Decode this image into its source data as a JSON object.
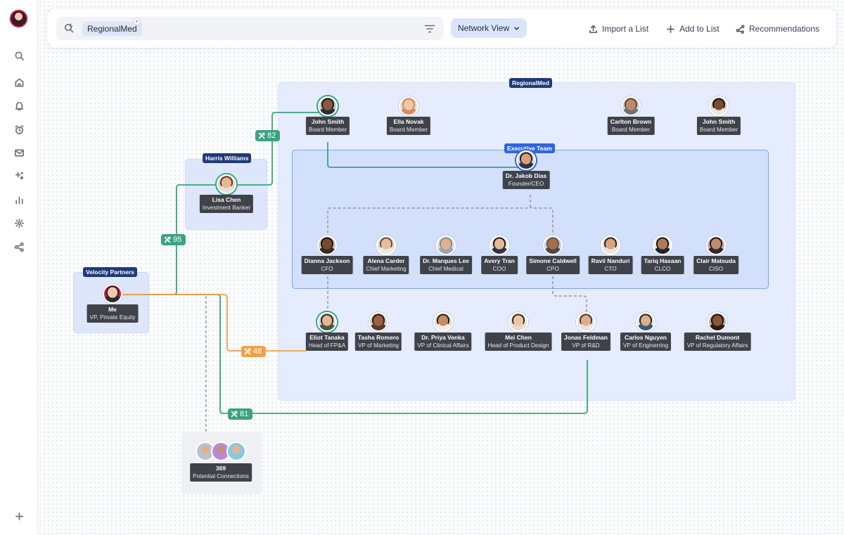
{
  "sidebar": {
    "items": [
      {
        "icon": "search-icon"
      },
      {
        "icon": "home-icon"
      },
      {
        "icon": "bell-icon"
      },
      {
        "icon": "alarm-clock-icon"
      },
      {
        "icon": "mail-icon"
      },
      {
        "icon": "sparkles-icon"
      },
      {
        "icon": "bar-chart-icon"
      },
      {
        "icon": "gear-icon"
      },
      {
        "icon": "network-icon"
      }
    ],
    "add_icon": "plus-icon"
  },
  "topbar": {
    "search_chip": "RegionalMed",
    "chip_close": "×",
    "view_label": "Network View",
    "import_label": "Import a List",
    "add_label": "Add to List",
    "recommend_label": "Recommendations"
  },
  "groups": {
    "regionalmed": "RegionalMed",
    "exec_team": "Executive Team",
    "harris": "Harris Williams",
    "velocity": "Velocity Partners"
  },
  "colors": {
    "green_path": "#3aa37c",
    "orange_path": "#f0a14a",
    "ceo_ring": "#2f66d9",
    "group_label": "#1f3a78"
  },
  "badges": {
    "b82": "82",
    "b95": "95",
    "b46": "46",
    "b81": "81"
  },
  "people": {
    "me": {
      "name": "Me",
      "title": "VP, Private Equity"
    },
    "lisa": {
      "name": "Lisa Chen",
      "title": "Investment Banker"
    },
    "john1": {
      "name": "John Smith",
      "title": "Board Member"
    },
    "ella": {
      "name": "Ella Novak",
      "title": "Board Member"
    },
    "carlton": {
      "name": "Carlton Brown",
      "title": "Board Member"
    },
    "john2": {
      "name": "John Smith",
      "title": "Board Member"
    },
    "jakob": {
      "name": "Dr. Jakob Dias",
      "title": "Founder/CEO"
    },
    "dianna": {
      "name": "Dianna Jackson",
      "title": "CFO"
    },
    "alena": {
      "name": "Alena Carder",
      "title": "Chief Marketing"
    },
    "marques": {
      "name": "Dr. Marques Lee",
      "title": "Chief Medical"
    },
    "avery": {
      "name": "Avery Tran",
      "title": "COO"
    },
    "simone": {
      "name": "Simone Caldwell",
      "title": "CPO"
    },
    "ravii": {
      "name": "Ravii Nanduri",
      "title": "CTO"
    },
    "tariq": {
      "name": "Tariq Hasaan",
      "title": "CLCO"
    },
    "clair": {
      "name": "Clair Matsuda",
      "title": "CISO"
    },
    "eliot": {
      "name": "Eliot Tanaka",
      "title": "Head of FP&A"
    },
    "tasha": {
      "name": "Tasha Romero",
      "title": "VP of Marketing"
    },
    "priya": {
      "name": "Dr. Priya Venka",
      "title": "VP of Clinical Affairs"
    },
    "mei": {
      "name": "Mei Chen",
      "title": "Head of Product Design"
    },
    "jonas": {
      "name": "Jonas Feldman",
      "title": "VP of R&D"
    },
    "carlos": {
      "name": "Carlos Nguyen",
      "title": "VP of Enginerring"
    },
    "rachel": {
      "name": "Rachel Dumont",
      "title": "VP of Regulatory Affairs"
    }
  },
  "potential": {
    "count": "369",
    "label": "Potential Connections"
  }
}
